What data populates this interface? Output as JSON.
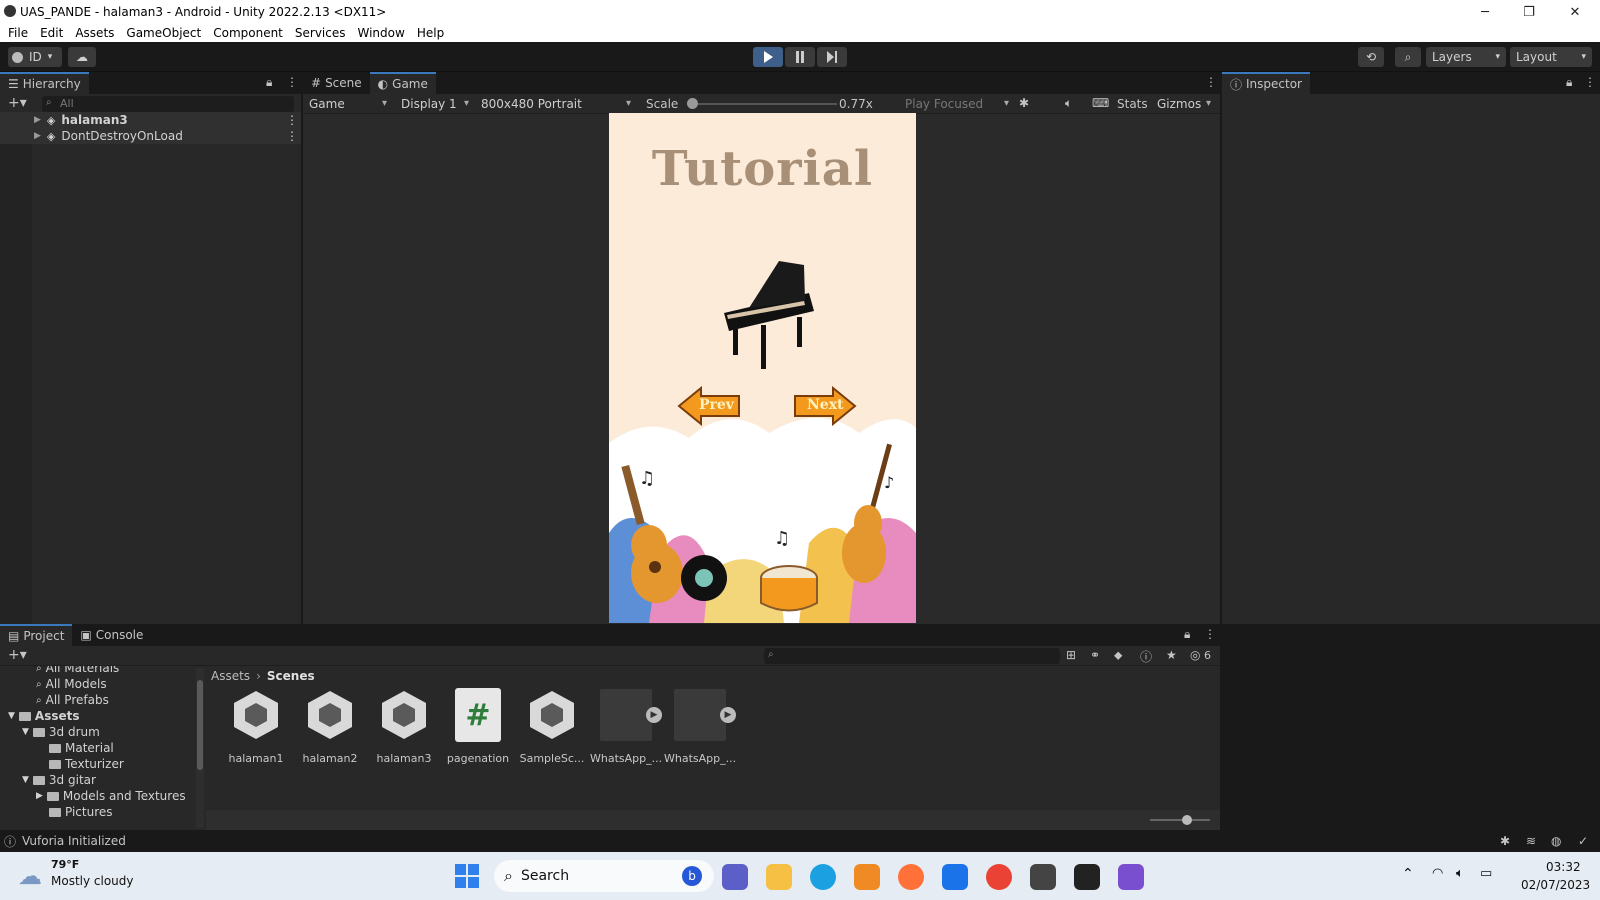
{
  "window": {
    "title": "UAS_PANDE - halaman3 - Android - Unity 2022.2.13 <DX11>",
    "minimize": "─",
    "restore": "❐",
    "close": "✕"
  },
  "menu": [
    "File",
    "Edit",
    "Assets",
    "GameObject",
    "Component",
    "Services",
    "Window",
    "Help"
  ],
  "toolbar": {
    "account": "ID",
    "layers": "Layers",
    "layout": "Layout"
  },
  "hierarchy": {
    "tab": "Hierarchy",
    "search_placeholder": "All",
    "items": [
      "halaman3",
      "DontDestroyOnLoad"
    ]
  },
  "game_view": {
    "tab_scene": "Scene",
    "tab_game": "Game",
    "mode": "Game",
    "display": "Display 1",
    "resolution": "800x480 Portrait",
    "scale_label": "Scale",
    "scale_value": "0.77x",
    "play_focused": "Play Focused",
    "stats": "Stats",
    "gizmos": "Gizmos",
    "scale_fraction": 0.0
  },
  "game": {
    "title": "Tutorial",
    "prev": "Prev",
    "next": "Next"
  },
  "inspector": {
    "tab": "Inspector"
  },
  "project": {
    "tab_project": "Project",
    "tab_console": "Console",
    "hidden_count": "6",
    "tree": [
      {
        "label": "All Materials",
        "indent": 1,
        "kind": "search"
      },
      {
        "label": "All Models",
        "indent": 1,
        "kind": "search"
      },
      {
        "label": "All Prefabs",
        "indent": 1,
        "kind": "search"
      },
      {
        "label": "Assets",
        "indent": 0,
        "kind": "root"
      },
      {
        "label": "3d drum",
        "indent": 1,
        "kind": "open"
      },
      {
        "label": "Material",
        "indent": 2,
        "kind": "folder"
      },
      {
        "label": "Texturizer",
        "indent": 2,
        "kind": "folder"
      },
      {
        "label": "3d gitar",
        "indent": 1,
        "kind": "open"
      },
      {
        "label": "Models and Textures",
        "indent": 2,
        "kind": "closed"
      },
      {
        "label": "Pictures",
        "indent": 2,
        "kind": "folder"
      }
    ],
    "breadcrumb": [
      "Assets",
      "Scenes"
    ],
    "assets": [
      {
        "label": "halaman1",
        "type": "unity"
      },
      {
        "label": "halaman2",
        "type": "unity"
      },
      {
        "label": "halaman3",
        "type": "unity"
      },
      {
        "label": "pagenation",
        "type": "script"
      },
      {
        "label": "SampleSc...",
        "type": "unity"
      },
      {
        "label": "WhatsApp_...",
        "type": "video"
      },
      {
        "label": "WhatsApp_...",
        "type": "video"
      }
    ]
  },
  "status": {
    "message": "Vuforia Initialized"
  },
  "taskbar": {
    "weather_temp": "79°F",
    "weather_desc": "Mostly cloudy",
    "search": "Search",
    "time": "03:32",
    "date": "02/07/2023"
  },
  "colors": {
    "accent_blue": "#3a79bb",
    "game_bg": "#fdebd9",
    "title_brown": "#a88f78",
    "arrow_orange": "#f39a1e"
  }
}
